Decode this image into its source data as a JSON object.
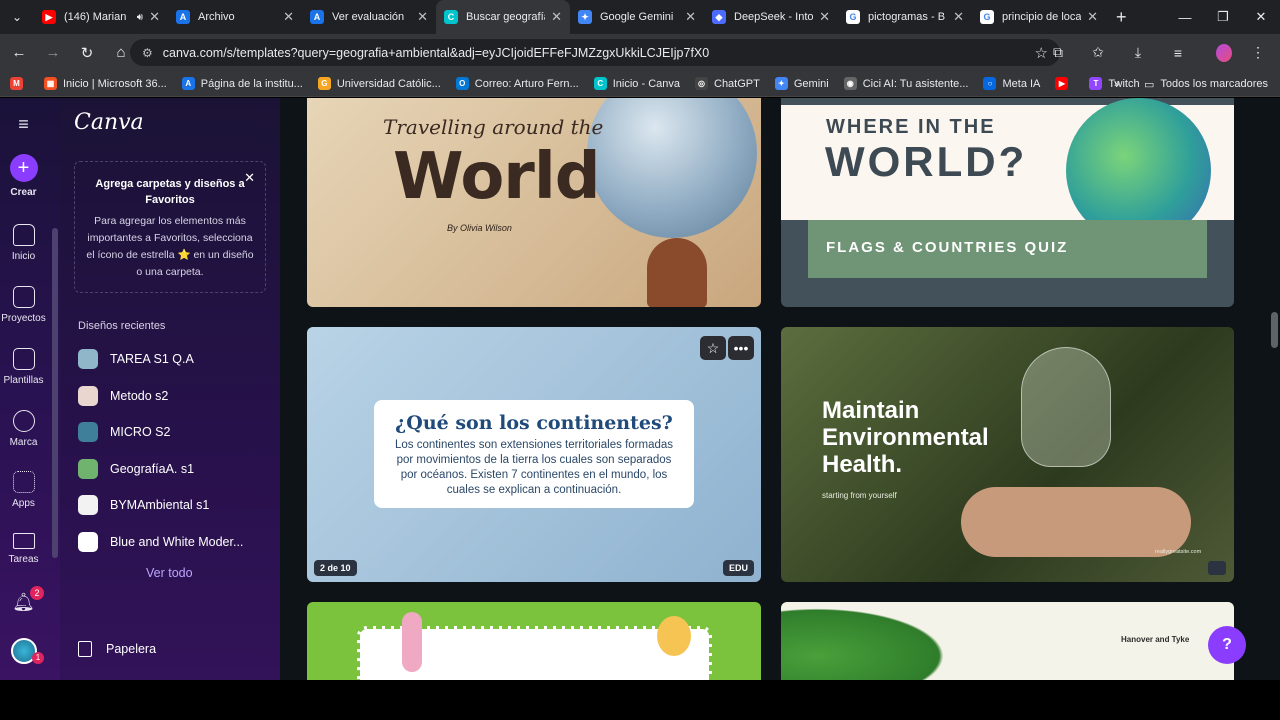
{
  "browser": {
    "tabs": [
      {
        "title": "(146) Marian",
        "icon_color": "#ff0000",
        "icon_char": "▶",
        "audio": true
      },
      {
        "title": "Archivo",
        "icon_color": "#1a73e8",
        "icon_char": "A"
      },
      {
        "title": "Ver evaluación",
        "icon_color": "#1a73e8",
        "icon_char": "A"
      },
      {
        "title": "Buscar geografía",
        "icon_color": "#00c4cc",
        "icon_char": "C",
        "active": true
      },
      {
        "title": "Google Gemini",
        "icon_color": "#4285f4",
        "icon_char": "✦"
      },
      {
        "title": "DeepSeek - Into",
        "icon_color": "#4d6bfe",
        "icon_char": "◆"
      },
      {
        "title": "pictogramas - B",
        "icon_color": "#ffffff",
        "icon_char": "G"
      },
      {
        "title": "principio de loca",
        "icon_color": "#ffffff",
        "icon_char": "G"
      }
    ],
    "url": "canva.com/s/templates?query=geografia+ambiental&adj=eyJCIjoidEFFeFJMZzgxUkkiLCJEIjp7fX0",
    "bookmarks": [
      {
        "label": "",
        "icon_color": "#ea4335",
        "icon_char": "M"
      },
      {
        "label": "Inicio | Microsoft 36...",
        "icon_color": "#f25022",
        "icon_char": "▦"
      },
      {
        "label": "Página de la institu...",
        "icon_color": "#1a73e8",
        "icon_char": "A"
      },
      {
        "label": "Universidad Católic...",
        "icon_color": "#f6a623",
        "icon_char": "G"
      },
      {
        "label": "Correo: Arturo Fern...",
        "icon_color": "#0078d4",
        "icon_char": "O"
      },
      {
        "label": "Inicio - Canva",
        "icon_color": "#00c4cc",
        "icon_char": "C"
      },
      {
        "label": "ChatGPT",
        "icon_color": "#444444",
        "icon_char": "◎"
      },
      {
        "label": "Gemini",
        "icon_color": "#4285f4",
        "icon_char": "✦"
      },
      {
        "label": "Cici AI: Tu asistente...",
        "icon_color": "#666666",
        "icon_char": "◉"
      },
      {
        "label": "Meta IA",
        "icon_color": "#0668e1",
        "icon_char": "○"
      },
      {
        "label": "",
        "icon_color": "#ff0000",
        "icon_char": "▶"
      },
      {
        "label": "Twitch",
        "icon_color": "#9146ff",
        "icon_char": "T"
      }
    ],
    "all_bookmarks_label": "Todos los marcadores"
  },
  "rail": {
    "create": "Crear",
    "items": [
      "Inicio",
      "Proyectos",
      "Plantillas",
      "Marca",
      "Apps",
      "Tareas"
    ],
    "notifications_badge": "2",
    "avatar_badge": "1"
  },
  "panel": {
    "logo": "Canva",
    "promo_title": "Agrega carpetas y diseños a Favoritos",
    "promo_body": "Para agregar los elementos más importantes a Favoritos, selecciona el ícono de estrella ⭐ en un diseño o una carpeta.",
    "recent_header": "Diseños recientes",
    "recent": [
      {
        "name": "TAREA S1 Q.A",
        "color": "#8fb7c9"
      },
      {
        "name": "Metodo s2",
        "color": "#e9d7cf"
      },
      {
        "name": "MICRO S2",
        "color": "#3f7f99"
      },
      {
        "name": "GeografíaA. s1",
        "color": "#6fb36f"
      },
      {
        "name": "BYMAmbiental s1",
        "color": "#f2f2f2"
      },
      {
        "name": "Blue and White Moder...",
        "color": "#ffffff"
      }
    ],
    "see_all": "Ver todo",
    "trash": "Papelera"
  },
  "templates": {
    "c1": {
      "sub": "Travelling around the",
      "title": "World",
      "by": "By Olivia Wilson"
    },
    "c2": {
      "where": "WHERE IN THE",
      "world": "WORLD?",
      "quiz": "FLAGS & COUNTRIES QUIZ"
    },
    "c3": {
      "question": "¿Qué son los continentes?",
      "body": "Los continentes son extensiones territoriales formadas por movimientos de la tierra los cuales son separados por océanos. Existen 7 continentes en el mundo, los cuales se explican a continuación.",
      "page": "2 de 10",
      "edu": "EDU"
    },
    "c4": {
      "title": "Maintain Environmental Health.",
      "sub": "starting from yourself",
      "url": "reallygreatsite.com"
    },
    "c6": {
      "name": "Hanover and Tyke"
    }
  },
  "help": "?"
}
